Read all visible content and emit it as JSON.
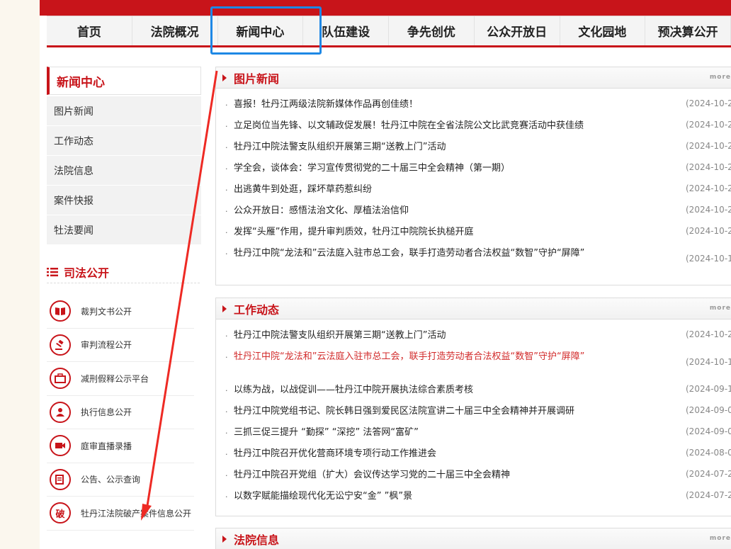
{
  "nav": {
    "items": [
      "首页",
      "法院概况",
      "新闻中心",
      "队伍建设",
      "争先创优",
      "公众开放日",
      "文化园地",
      "预决算公开"
    ]
  },
  "sidebar": {
    "title": "新闻中心",
    "items": [
      "图片新闻",
      "工作动态",
      "法院信息",
      "案件快报",
      "牡法要闻"
    ]
  },
  "judicial": {
    "title": "司法公开",
    "items": [
      {
        "label": "裁判文书公开",
        "icon": "book-icon"
      },
      {
        "label": "审判流程公开",
        "icon": "gavel-icon"
      },
      {
        "label": "减刑假释公示平台",
        "icon": "briefcase-icon"
      },
      {
        "label": "执行信息公开",
        "icon": "user-icon"
      },
      {
        "label": "庭审直播录播",
        "icon": "camera-icon"
      },
      {
        "label": "公告、公示查询",
        "icon": "notice-icon"
      },
      {
        "label": "牡丹江法院破产案件信息公开",
        "icon": "bankruptcy-icon",
        "glyph": "破"
      }
    ]
  },
  "panels": [
    {
      "title": "图片新闻",
      "more": "more",
      "items": [
        {
          "text": "喜报！牡丹江两级法院新媒体作品再创佳绩！",
          "date": "(2024-10-2"
        },
        {
          "text": "立足岗位当先锋、以文辅政促发展！牡丹江中院在全省法院公文比武竞赛活动中获佳绩",
          "date": "(2024-10-2"
        },
        {
          "text": "牡丹江中院法警支队组织开展第三期“送教上门”活动",
          "date": "(2024-10-2"
        },
        {
          "text": "学全会，谈体会：学习宣传贯彻党的二十届三中全会精神（第一期）",
          "date": "(2024-10-2"
        },
        {
          "text": "出逃黄牛到处逛，踩坏草药惹纠纷",
          "date": "(2024-10-2"
        },
        {
          "text": "公众开放日：感悟法治文化、厚植法治信仰",
          "date": "(2024-10-2"
        },
        {
          "text": "发挥“头雁”作用，提升审判质效，牡丹江中院院长执槌开庭",
          "date": "(2024-10-2"
        },
        {
          "text": "牡丹江中院“龙法和”云法庭入驻市总工会，联手打造劳动者合法权益“数智”守护“屏障”",
          "date": "(2024-10-1"
        }
      ]
    },
    {
      "title": "工作动态",
      "more": "more",
      "items": [
        {
          "text": "牡丹江中院法警支队组织开展第三期“送教上门”活动",
          "date": "(2024-10-2"
        },
        {
          "text": "牡丹江中院“龙法和”云法庭入驻市总工会，联手打造劳动者合法权益“数智”守护“屏障”",
          "date": "(2024-10-1"
        },
        {
          "text": "以练为战，以战促训——牡丹江中院开展执法综合素质考核",
          "date": "(2024-09-1"
        },
        {
          "text": "牡丹江中院党组书记、院长韩日强到爱民区法院宣讲二十届三中全会精神并开展调研",
          "date": "(2024-09-0"
        },
        {
          "text": "三抓三促三提升 “勤探” “深挖” 法答网“富矿”",
          "date": "(2024-09-0"
        },
        {
          "text": "牡丹江中院召开优化营商环境专项行动工作推进会",
          "date": "(2024-08-0"
        },
        {
          "text": "牡丹江中院召开党组（扩大）会议传达学习党的二十届三中全会精神",
          "date": "(2024-07-2"
        },
        {
          "text": "以数字赋能描绘现代化无讼宁安“金” ”枫”景",
          "date": "(2024-07-2"
        }
      ]
    },
    {
      "title": "法院信息",
      "more": "more",
      "items": []
    }
  ],
  "bullet": "·",
  "colors": {
    "brand_red": "#c8141a",
    "highlight_blue": "#1e88e5",
    "link_red": "#d22b2b"
  }
}
